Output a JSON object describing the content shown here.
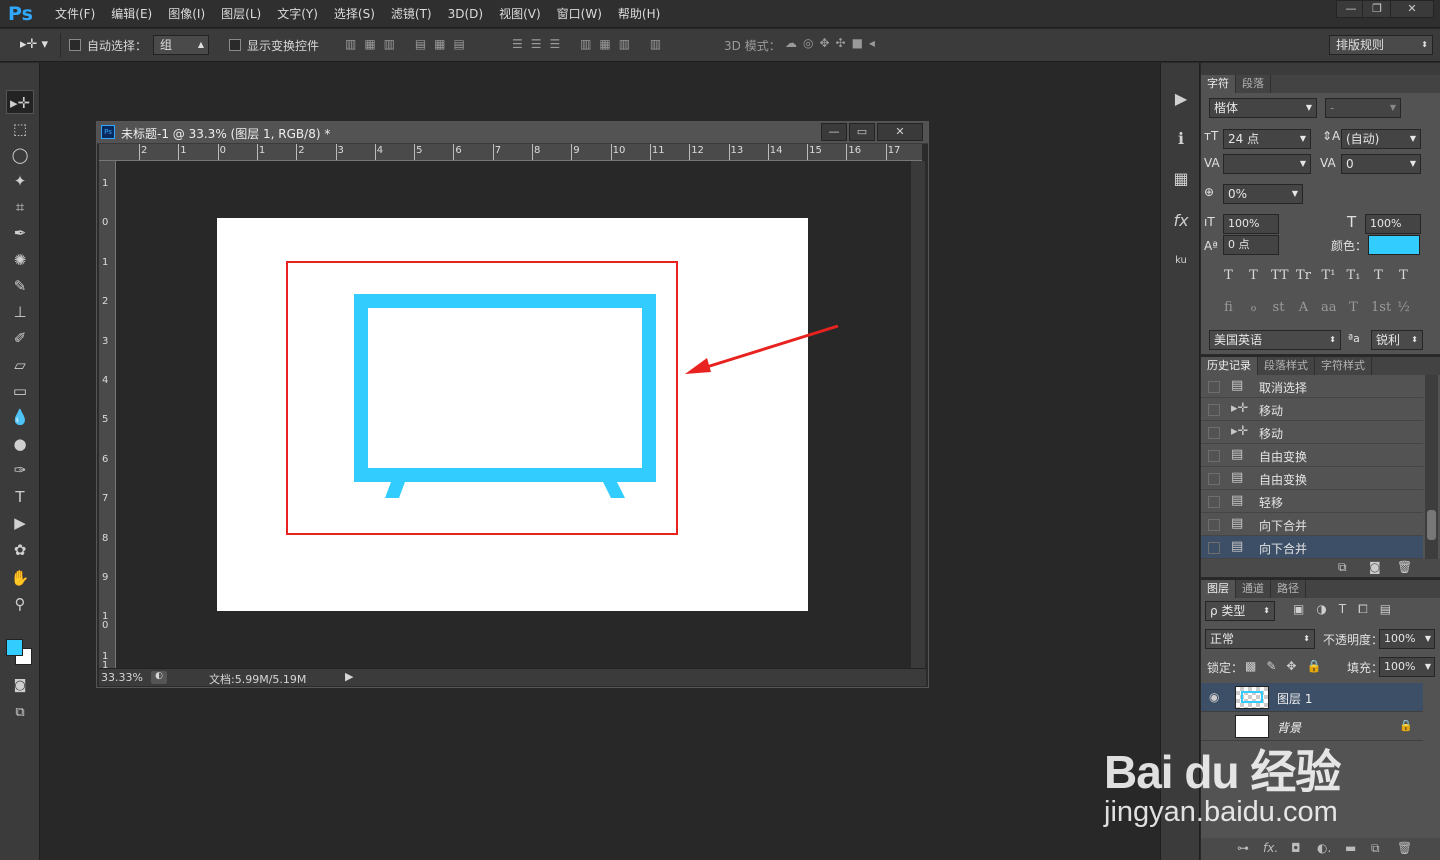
{
  "app": {
    "logo": "Ps"
  },
  "menu": [
    "文件(F)",
    "编辑(E)",
    "图像(I)",
    "图层(L)",
    "文字(Y)",
    "选择(S)",
    "滤镜(T)",
    "3D(D)",
    "视图(V)",
    "窗口(W)",
    "帮助(H)"
  ],
  "options": {
    "auto_select_label": "自动选择：",
    "auto_select_value": "组",
    "show_transform_label": "显示变换控件",
    "mode3d_label": "3D 模式：",
    "workspace_value": "排版规则"
  },
  "document": {
    "title": "未标题-1 @ 33.3% (图层 1, RGB/8) *",
    "ruler_h": [
      "2",
      "1",
      "0",
      "1",
      "2",
      "3",
      "4",
      "5",
      "6",
      "7",
      "8",
      "9",
      "10",
      "11",
      "12",
      "13",
      "14",
      "15",
      "16",
      "17"
    ],
    "ruler_v": [
      "1",
      "0",
      "1",
      "2",
      "3",
      "4",
      "5",
      "6",
      "7",
      "8",
      "9",
      "1\n0",
      "1\n1"
    ],
    "zoom": "33.33%",
    "doc_info": "文档:5.99M/5.19M"
  },
  "character_panel": {
    "tabs": [
      "字符",
      "段落"
    ],
    "font_family": "楷体",
    "font_style": "-",
    "font_size": "24 点",
    "leading": "(自动)",
    "kerning": "",
    "tracking": "0",
    "tsume": "0%",
    "vertical_scale": "100%",
    "horizontal_scale": "100%",
    "baseline": "0 点",
    "color_label": "颜色：",
    "color_value": "#33ccff",
    "style_buttons": [
      "T",
      "T",
      "TT",
      "Tr",
      "T¹",
      "T₁",
      "T",
      "T"
    ],
    "opentype_buttons": [
      "fi",
      "ℴ",
      "st",
      "A",
      "aa",
      "T",
      "1st",
      "½"
    ],
    "language": "美国英语",
    "aa_label": "ªa",
    "antialias": "锐利"
  },
  "history_panel": {
    "tabs": [
      "历史记录",
      "段落样式",
      "字符样式"
    ],
    "items": [
      {
        "icon": "document-icon",
        "label": "取消选择"
      },
      {
        "icon": "move-icon",
        "label": "移动"
      },
      {
        "icon": "move-icon",
        "label": "移动"
      },
      {
        "icon": "document-icon",
        "label": "自由变换"
      },
      {
        "icon": "document-icon",
        "label": "自由变换"
      },
      {
        "icon": "document-icon",
        "label": "轻移"
      },
      {
        "icon": "document-icon",
        "label": "向下合并"
      },
      {
        "icon": "document-icon",
        "label": "向下合并"
      }
    ]
  },
  "layers_panel": {
    "tabs": [
      "图层",
      "通道",
      "路径"
    ],
    "filter": "ρ 类型",
    "blend_mode": "正常",
    "opacity_label": "不透明度：",
    "opacity": "100%",
    "lock_label": "锁定：",
    "fill_label": "填充：",
    "fill": "100%",
    "layers": [
      {
        "name": "图层 1",
        "visible": true,
        "selected": true
      },
      {
        "name": "背景",
        "visible": false,
        "locked": true
      }
    ]
  },
  "watermark": {
    "brand": "Bai du 经验",
    "url": "jingyan.baidu.com"
  },
  "colors": {
    "accent": "#33ccff",
    "annotation": "#e8231f",
    "foreground": "#33ccff",
    "background": "#ffffff"
  }
}
